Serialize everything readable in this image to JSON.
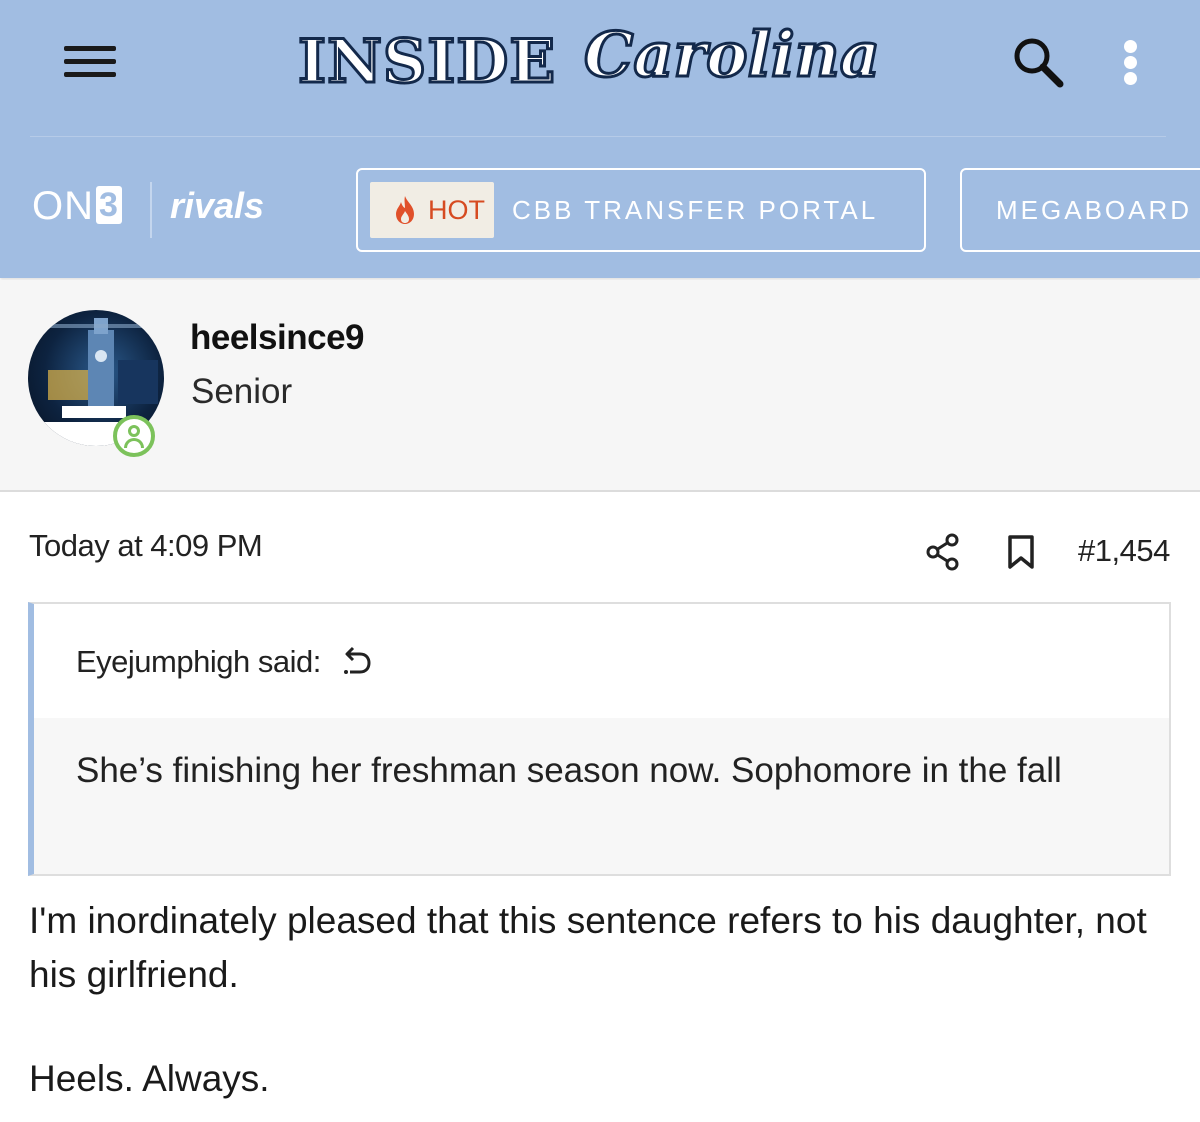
{
  "header": {
    "logo_inside": "INSIDE",
    "logo_carolina": "Carolina",
    "background_color": "#a1bde2",
    "menu_icon": "hamburger-menu-icon",
    "search_icon": "search-icon",
    "more_icon": "more-vertical-icon",
    "brand_on3": "ON",
    "brand_on3_digit": "3",
    "brand_rivals": "rivals",
    "nav": [
      {
        "badge": "HOT",
        "badge_icon": "flame-icon",
        "label": "CBB TRANSFER PORTAL"
      },
      {
        "label": "MEGABOARD"
      }
    ]
  },
  "author": {
    "username": "heelsince9",
    "title": "Senior",
    "status_icon": "online-user-icon",
    "status_color": "#7cc25b"
  },
  "post": {
    "timestamp": "Today at 4:09 PM",
    "share_icon": "share-icon",
    "bookmark_icon": "bookmark-icon",
    "number": "#1,454",
    "quote": {
      "author_line": "Eyejumphigh said:",
      "jump_icon": "jump-to-quote-icon",
      "text": "She’s finishing her freshman season now. Sophomore in the fall"
    },
    "body": [
      "I'm inordinately pleased that this sentence refers to his daughter, not his girlfriend.",
      "Heels. Always."
    ]
  }
}
